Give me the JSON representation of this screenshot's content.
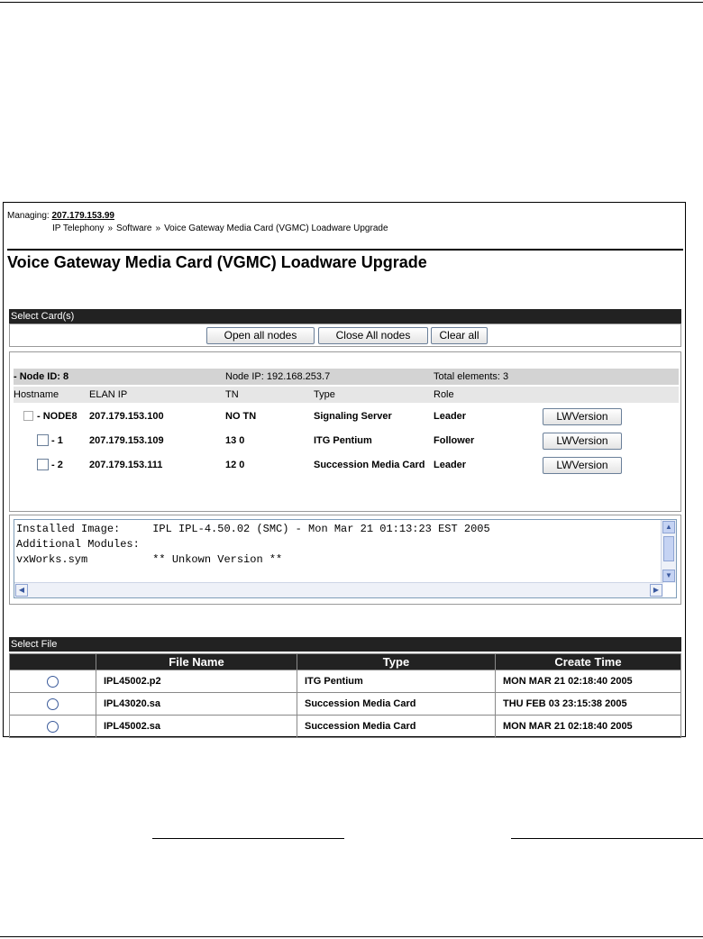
{
  "header": {
    "managing_label": "Managing:",
    "managing_ip": "207.179.153.99",
    "breadcrumb": [
      "IP Telephony",
      "Software",
      "Voice Gateway Media Card (VGMC) Loadware Upgrade"
    ],
    "breadcrumb_sep": "»",
    "page_title": "Voice Gateway Media Card (VGMC) Loadware Upgrade"
  },
  "select_card": {
    "section_label": "Select Card(s)",
    "buttons": {
      "open_all": "Open all nodes",
      "close_all": "Close All nodes",
      "clear_all": "Clear all"
    },
    "node": {
      "id_label": "- Node ID: 8",
      "ip_label": "Node IP: 192.168.253.7",
      "total_label": "Total elements: 3"
    },
    "columns": {
      "hostname": "Hostname",
      "elan_ip": "ELAN IP",
      "tn": "TN",
      "type": "Type",
      "role": "Role"
    },
    "rows": [
      {
        "hostname": "- NODE8",
        "elan_ip": "207.179.153.100",
        "tn": "NO TN",
        "type": "Signaling Server",
        "role": "Leader",
        "button": "LWVersion"
      },
      {
        "hostname": "- 1",
        "elan_ip": "207.179.153.109",
        "tn": "13 0",
        "type": "ITG Pentium",
        "role": "Follower",
        "button": "LWVersion"
      },
      {
        "hostname": "- 2",
        "elan_ip": "207.179.153.111",
        "tn": "12 0",
        "type": "Succession Media Card",
        "role": "Leader",
        "button": "LWVersion"
      }
    ]
  },
  "info_text": "Installed Image:     IPL IPL-4.50.02 (SMC) - Mon Mar 21 01:13:23 EST 2005\nAdditional Modules:\nvxWorks.sym          ** Unkown Version **",
  "select_file": {
    "section_label": "Select File",
    "columns": {
      "select": "",
      "file_name": "File Name",
      "type": "Type",
      "create_time": "Create Time"
    },
    "rows": [
      {
        "file_name": "IPL45002.p2",
        "type": "ITG Pentium",
        "create_time": "MON MAR 21 02:18:40 2005"
      },
      {
        "file_name": "IPL43020.sa",
        "type": "Succession Media Card",
        "create_time": "THU FEB 03 23:15:38 2005"
      },
      {
        "file_name": "IPL45002.sa",
        "type": "Succession Media Card",
        "create_time": "MON MAR 21 02:18:40 2005"
      }
    ]
  }
}
